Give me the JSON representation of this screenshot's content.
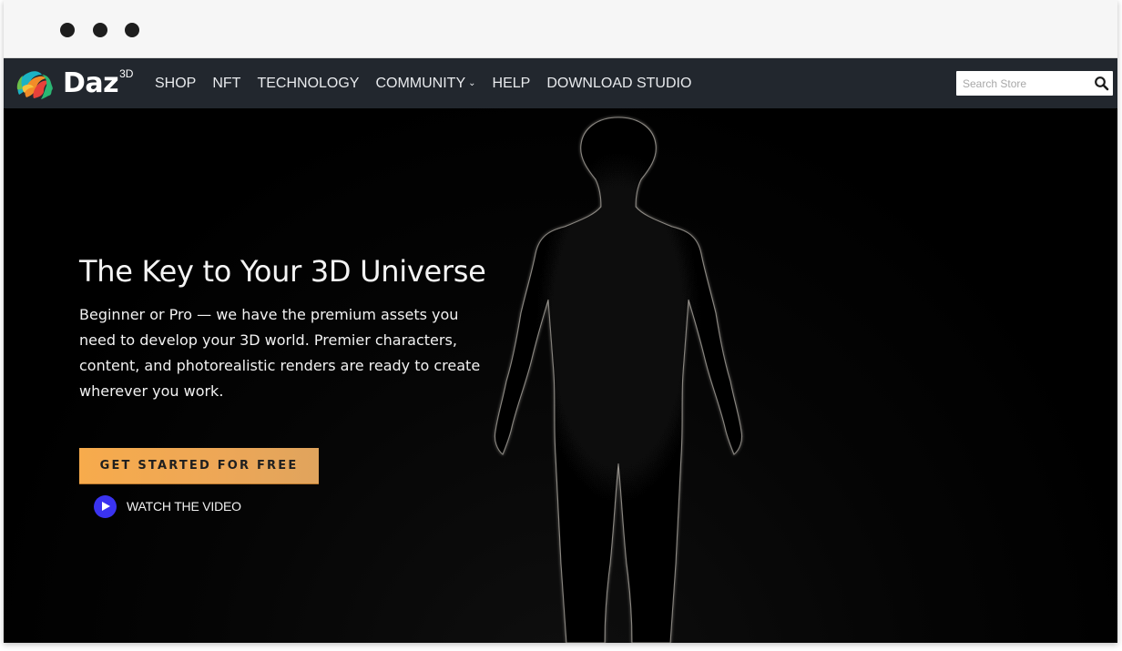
{
  "window": {
    "traffic_lights": [
      "close",
      "minimize",
      "maximize"
    ]
  },
  "navbar": {
    "logo": {
      "wordmark": "Daz",
      "superscript": "3D",
      "icon": "daz3d-logo-icon"
    },
    "links": [
      {
        "label": "SHOP",
        "has_dropdown": false
      },
      {
        "label": "NFT",
        "has_dropdown": false
      },
      {
        "label": "TECHNOLOGY",
        "has_dropdown": false
      },
      {
        "label": "COMMUNITY",
        "has_dropdown": true
      },
      {
        "label": "HELP",
        "has_dropdown": false
      },
      {
        "label": "DOWNLOAD STUDIO",
        "has_dropdown": false
      }
    ],
    "dropdown_icon": "chevron-down-icon",
    "search": {
      "placeholder": "Search Store",
      "value": "",
      "icon": "search-icon"
    },
    "background_color": "#22272e"
  },
  "hero": {
    "title": "The Key to Your 3D Universe",
    "body": "Beginner or Pro — we have the premium assets you need to develop your 3D world. Premier characters, content, and photorealistic renders are ready to create wherever you work.",
    "cta": {
      "label": "GET STARTED FOR FREE",
      "color_start": "#f7ab4c",
      "color_end": "#e0a45d"
    },
    "video_link": {
      "label": "WATCH THE VIDEO",
      "icon": "play-icon",
      "icon_color": "#3a33f0"
    },
    "image": "rim-lit-3d-human-figure"
  }
}
